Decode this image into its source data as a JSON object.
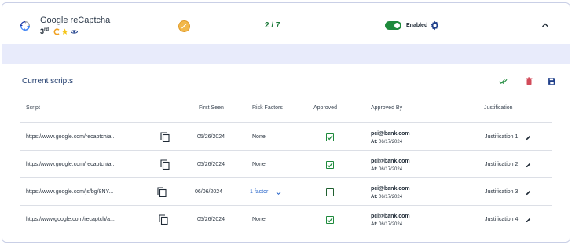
{
  "app": {
    "name": "Google reCaptcha",
    "party_label": "3",
    "party_suffix": "rd",
    "script_count": "2 / 7",
    "enabled_label": "Enabled"
  },
  "section": {
    "title": "Current scripts"
  },
  "table": {
    "columns": [
      "Script",
      "First Seen",
      "Risk Factors",
      "Approved",
      "Approved By",
      "Justification"
    ],
    "rows": [
      {
        "script": "https://www.google.com/recaptch/a...",
        "first_seen": "05/26/2024",
        "risk": "None",
        "approved": true,
        "by": "pci@bank.com",
        "at_label": "At:",
        "at": "06/17/2024",
        "justification": "Justification 1"
      },
      {
        "script": "https://www.google.com/recaptch/a...",
        "first_seen": "05/26/2024",
        "risk": "None",
        "approved": true,
        "by": "pci@bank.com",
        "at_label": "At:",
        "at": "06/17/2024",
        "justification": "Justification 2"
      },
      {
        "script": "https://www.google.com/js/bg/8NY...",
        "first_seen": "06/06/2024",
        "risk": "1 factor",
        "approved": false,
        "by": "pci@bank.com",
        "at_label": "At:",
        "at": "06/17/2024",
        "justification": "Justification 3"
      },
      {
        "script": "https://wwwgoogle.com/recaptch/a...",
        "first_seen": "05/26/2024",
        "risk": "None",
        "approved": true,
        "by": "pci@bank.com",
        "at_label": "At:",
        "at": "06/17/2024",
        "justification": "Justification 4"
      }
    ]
  },
  "colors": {
    "accent_green": "#1e8a3c",
    "band": "#e8ebfb",
    "link_blue": "#2563c9",
    "delete_red": "#d24b5a",
    "save_blue": "#1f3f8a"
  },
  "icons": [
    "recaptcha-logo-icon",
    "c-badge-icon",
    "star-icon",
    "eye-icon",
    "status-circle-icon",
    "toggle-switch",
    "gear-icon",
    "chevron-up-icon",
    "double-check-icon",
    "trash-icon",
    "save-icon",
    "copy-icon",
    "chevron-down-icon",
    "pencil-icon"
  ]
}
